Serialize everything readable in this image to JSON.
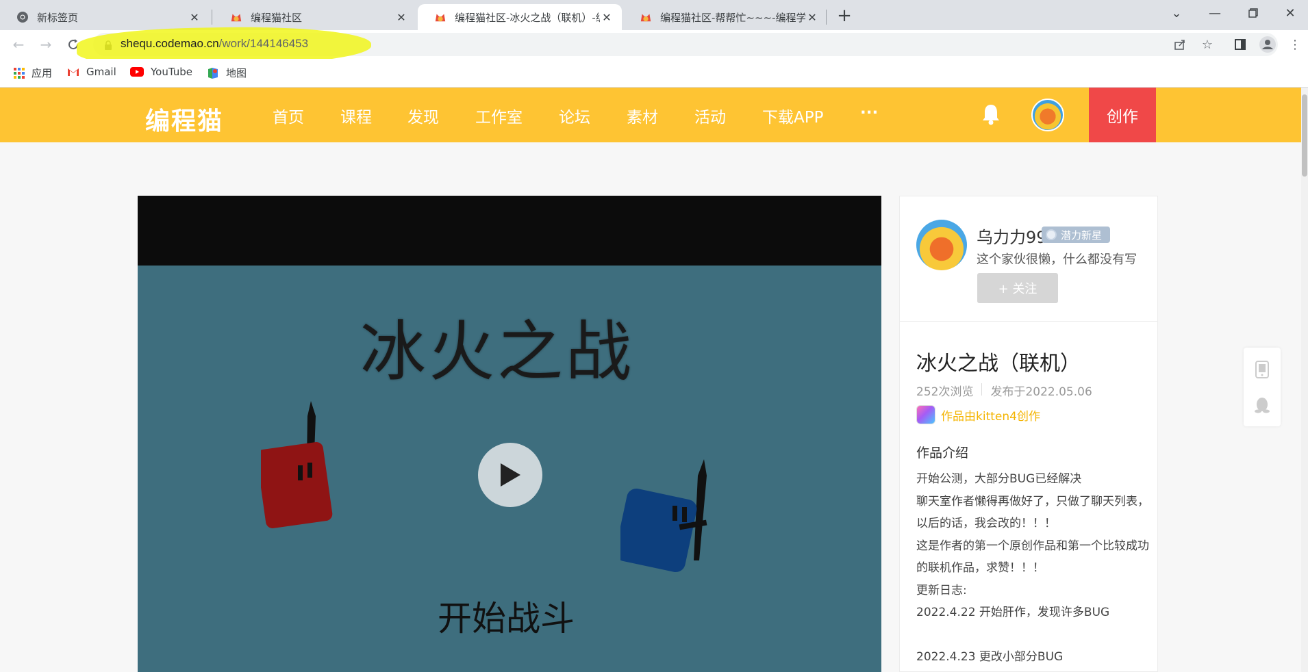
{
  "browser": {
    "tabs": [
      {
        "title": "新标签页",
        "active": false
      },
      {
        "title": "编程猫社区",
        "active": false
      },
      {
        "title": "编程猫社区-冰火之战（联机）-编",
        "active": true
      },
      {
        "title": "编程猫社区-帮帮忙~~~-编程学习",
        "active": false
      }
    ],
    "url_host": "shequ.codemao.cn",
    "url_path": "/work/144146453",
    "bookmarks": [
      "应用",
      "Gmail",
      "YouTube",
      "地图"
    ]
  },
  "site": {
    "logo": "编程猫",
    "nav": [
      "首页",
      "课程",
      "发现",
      "工作室",
      "论坛",
      "素材",
      "活动",
      "下载APP",
      "···"
    ],
    "create_label": "创作"
  },
  "player": {
    "game_title": "冰火之战",
    "start_label": "开始战斗"
  },
  "author": {
    "name": "乌力力99",
    "badge": "潜力新星",
    "bio": "这个家伙很懒，什么都没有写",
    "follow_label": "+ 关注"
  },
  "work": {
    "title": "冰火之战（联机）",
    "views": "252次浏览",
    "published": "发布于2022.05.06",
    "made_by": "作品由kitten4创作",
    "intro_title": "作品介绍",
    "intro_lines": [
      "开始公测，大部分BUG已经解决",
      "聊天室作者懒得再做好了，只做了聊天列表，以后的话，我会改的！！！",
      "这是作者的第一个原创作品和第一个比较成功的联机作品，求赞！！！",
      "更新日志:",
      "2022.4.22 开始肝作，发现许多BUG",
      "",
      "2022.4.23 更改小部分BUG"
    ]
  },
  "colors": {
    "header_bg": "#fec433",
    "create_bg": "#f04848",
    "player_bg": "#3e6e7e",
    "red_cube": "#8f1414",
    "blue_cube": "#0d3f7d",
    "kitten_text": "#f4b400"
  }
}
